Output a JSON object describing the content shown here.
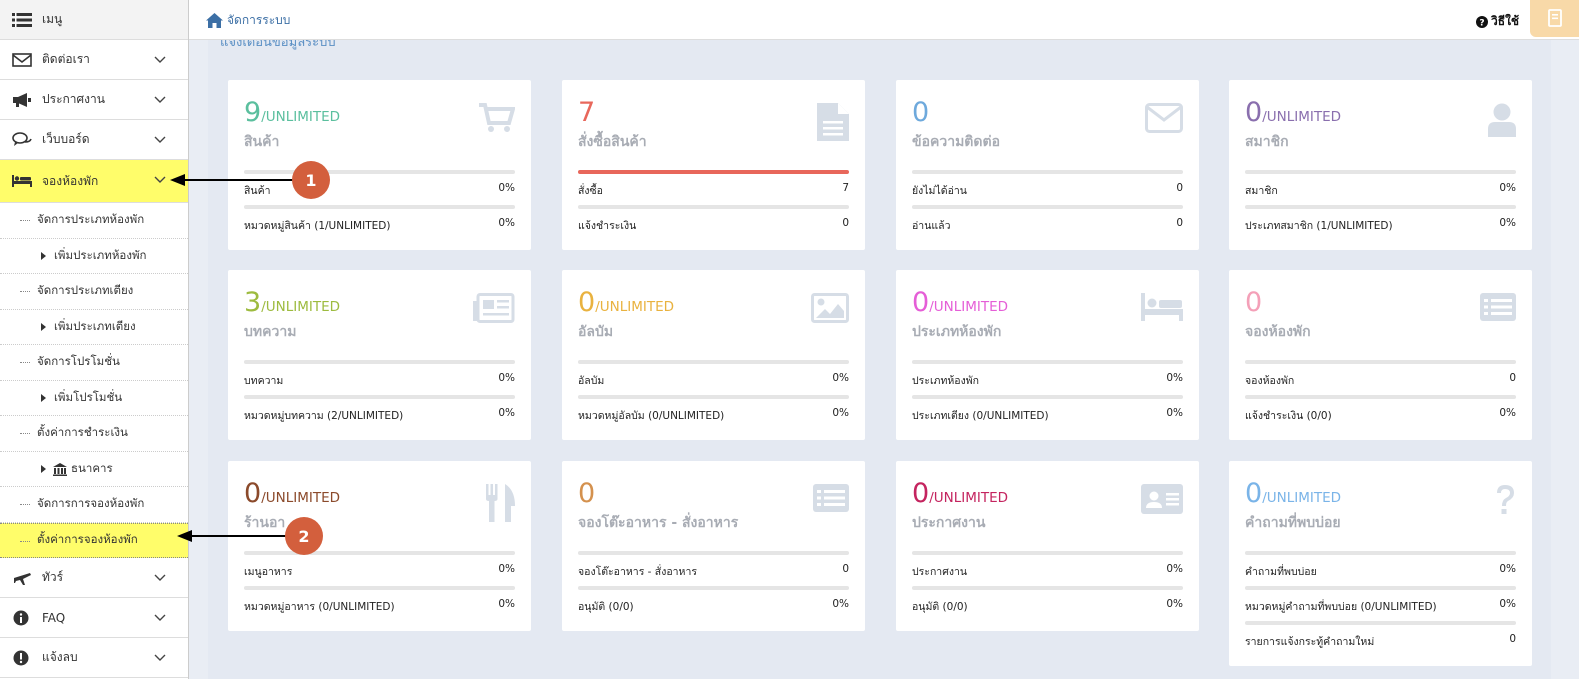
{
  "topbar": {
    "breadcrumb": "จัดการระบบ",
    "help": "วิธีใช้"
  },
  "main": {
    "partial_header": "แจ้งเตือนข้อมูลระบบ"
  },
  "sidebar": {
    "menu": "เมนู",
    "items": [
      {
        "label": "ติดต่อเรา",
        "icon": "envelope-icon"
      },
      {
        "label": "ประกาศงาน",
        "icon": "megaphone-icon"
      },
      {
        "label": "เว็บบอร์ด",
        "icon": "comments-icon"
      },
      {
        "label": "จองห้องพัก",
        "icon": "bed-icon"
      }
    ],
    "subitems": [
      "จัดการประเภทห้องพัก",
      "เพิ่มประเภทห้องพัก",
      "จัดการประเภทเตียง",
      "เพิ่มประเภทเตียง",
      "จัดการโปรโมชั่น",
      "เพิ่มโปรโมชั่น",
      "ตั้งค่าการชำระเงิน",
      "ธนาคาร",
      "จัดการการจองห้องพัก",
      "ตั้งค่าการจองห้องพัก"
    ],
    "bottom": [
      {
        "label": "ทัวร์",
        "icon": "plane-icon"
      },
      {
        "label": "FAQ",
        "icon": "info-icon"
      },
      {
        "label": "แจ้งลบ",
        "icon": "exclamation-icon"
      }
    ]
  },
  "callouts": [
    "1",
    "2"
  ],
  "cards": [
    {
      "num": "9",
      "unit": "/UNLIMITED",
      "title": "สินค้า",
      "color": "#5bbf9e",
      "icon": "cart-icon",
      "progress": 0,
      "rows": [
        {
          "label": "สินค้า",
          "value": "0%"
        },
        {
          "label": "หมวดหมู่สินค้า (1/UNLIMITED)",
          "value": "0%"
        }
      ]
    },
    {
      "num": "7",
      "unit": "",
      "title": "สั่งซื้อสินค้า",
      "color": "#e8675b",
      "icon": "document-icon",
      "progress": 1,
      "rows": [
        {
          "label": "สั่งซื้อ",
          "value": "7"
        },
        {
          "label": "แจ้งชำระเงิน",
          "value": "0"
        }
      ]
    },
    {
      "num": "0",
      "unit": "",
      "title": "ข้อความติดต่อ",
      "color": "#6ea9dc",
      "icon": "envelope-icon",
      "progress": 0,
      "rows": [
        {
          "label": "ยังไม่ได้อ่าน",
          "value": "0"
        },
        {
          "label": "อ่านแล้ว",
          "value": "0"
        }
      ]
    },
    {
      "num": "0",
      "unit": "/UNLIMITED",
      "title": "สมาชิก",
      "color": "#8a6fae",
      "icon": "user-icon",
      "progress": 0,
      "rows": [
        {
          "label": "สมาชิก",
          "value": "0%"
        },
        {
          "label": "ประเภทสมาชิก (1/UNLIMITED)",
          "value": "0%"
        }
      ]
    },
    {
      "num": "3",
      "unit": "/UNLIMITED",
      "title": "บทความ",
      "color": "#9dbb3f",
      "icon": "newspaper-icon",
      "progress": 0,
      "rows": [
        {
          "label": "บทความ",
          "value": "0%"
        },
        {
          "label": "หมวดหมู่บทความ (2/UNLIMITED)",
          "value": "0%"
        }
      ]
    },
    {
      "num": "0",
      "unit": "/UNLIMITED",
      "title": "อัลบัม",
      "color": "#e9b23f",
      "icon": "image-icon",
      "progress": 0,
      "rows": [
        {
          "label": "อัลบัม",
          "value": "0%"
        },
        {
          "label": "หมวดหมู่อัลบัม (0/UNLIMITED)",
          "value": "0%"
        }
      ]
    },
    {
      "num": "0",
      "unit": "/UNLIMITED",
      "title": "ประเภทห้องพัก",
      "color": "#e55ed7",
      "icon": "bed-icon",
      "progress": 0,
      "rows": [
        {
          "label": "ประเภทห้องพัก",
          "value": "0%"
        },
        {
          "label": "ประเภทเตียง (0/UNLIMITED)",
          "value": "0%"
        }
      ]
    },
    {
      "num": "0",
      "unit": "",
      "title": "จองห้องพัก",
      "color": "#f4a0b8",
      "icon": "list-icon",
      "progress": 0,
      "rows": [
        {
          "label": "จองห้องพัก",
          "value": "0"
        },
        {
          "label": "แจ้งชำระเงิน (0/0)",
          "value": "0%"
        }
      ]
    },
    {
      "num": "0",
      "unit": "/UNLIMITED",
      "title": "ร้านอา",
      "color": "#8b4a2b",
      "icon": "utensils-icon",
      "progress": 0,
      "rows": [
        {
          "label": "เมนูอาหาร",
          "value": "0%"
        },
        {
          "label": "หมวดหมู่อาหาร (0/UNLIMITED)",
          "value": "0%"
        }
      ]
    },
    {
      "num": "0",
      "unit": "",
      "title": "จองโต๊ะอาหาร - สั่งอาหาร",
      "color": "#d4914e",
      "icon": "list-icon",
      "progress": 0,
      "rows": [
        {
          "label": "จองโต๊ะอาหาร - สั่งอาหาร",
          "value": "0"
        },
        {
          "label": "อนุมัติ (0/0)",
          "value": "0%"
        }
      ]
    },
    {
      "num": "0",
      "unit": "/UNLIMITED",
      "title": "ประกาศงาน",
      "color": "#c4245f",
      "icon": "id-card-icon",
      "progress": 0,
      "rows": [
        {
          "label": "ประกาศงาน",
          "value": "0%"
        },
        {
          "label": "อนุมัติ (0/0)",
          "value": "0%"
        }
      ]
    },
    {
      "num": "0",
      "unit": "/UNLIMITED",
      "title": "คำถามที่พบบ่อย",
      "color": "#7ab4e8",
      "icon": "question-icon",
      "progress": 0,
      "rows": [
        {
          "label": "คำถามที่พบบ่อย",
          "value": "0%"
        },
        {
          "label": "หมวดหมู่คำถามที่พบบ่อย (0/UNLIMITED)",
          "value": "0%"
        },
        {
          "label": "รายการแจ้งกระทู้คำถามใหม่",
          "value": "0"
        }
      ]
    }
  ]
}
